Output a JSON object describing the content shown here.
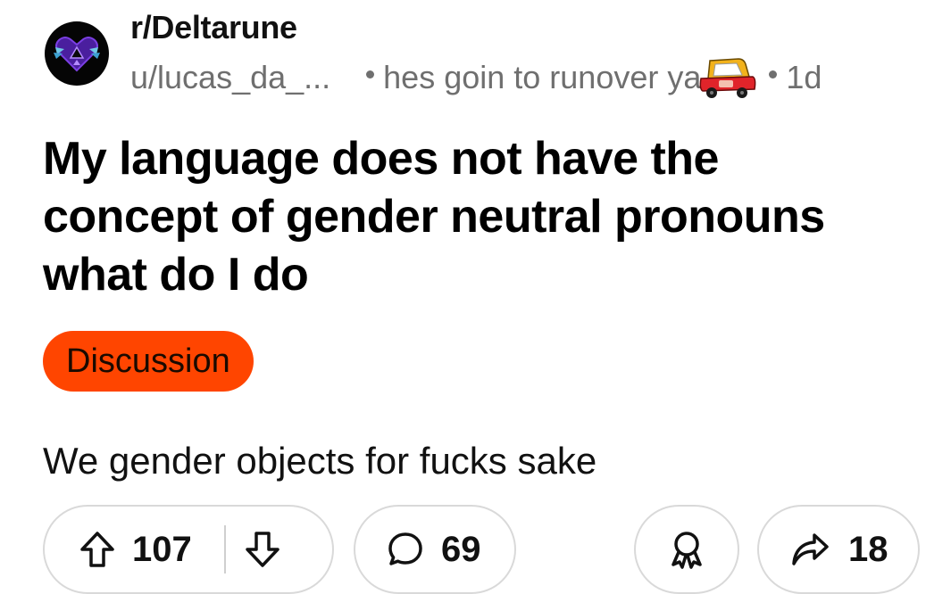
{
  "post": {
    "subreddit": "r/Deltarune",
    "author": "u/lucas_da_...",
    "author_flair_text": "hes goin to runover ya",
    "author_flair_emoji": "toy-car-icon",
    "age": "1d",
    "title": "My language does not have the concept of gender neutral pronouns what do I do",
    "post_flair": "Discussion",
    "body": "We gender objects for fucks sake"
  },
  "actions": {
    "upvotes": "107",
    "comments": "69",
    "shares": "18"
  },
  "icons": {
    "subreddit_avatar": "delta-heart-emblem-icon",
    "upvote": "arrow-up-icon",
    "downvote": "arrow-down-icon",
    "comment": "speech-bubble-icon",
    "award": "award-ribbon-icon",
    "share": "share-arrow-icon"
  },
  "colors": {
    "flair_background": "#ff4500",
    "meta_text": "#6f6f6f",
    "pill_border": "#d9d9d9",
    "avatar_background": "#050505",
    "emblem_accent": "#7b3fe4"
  }
}
